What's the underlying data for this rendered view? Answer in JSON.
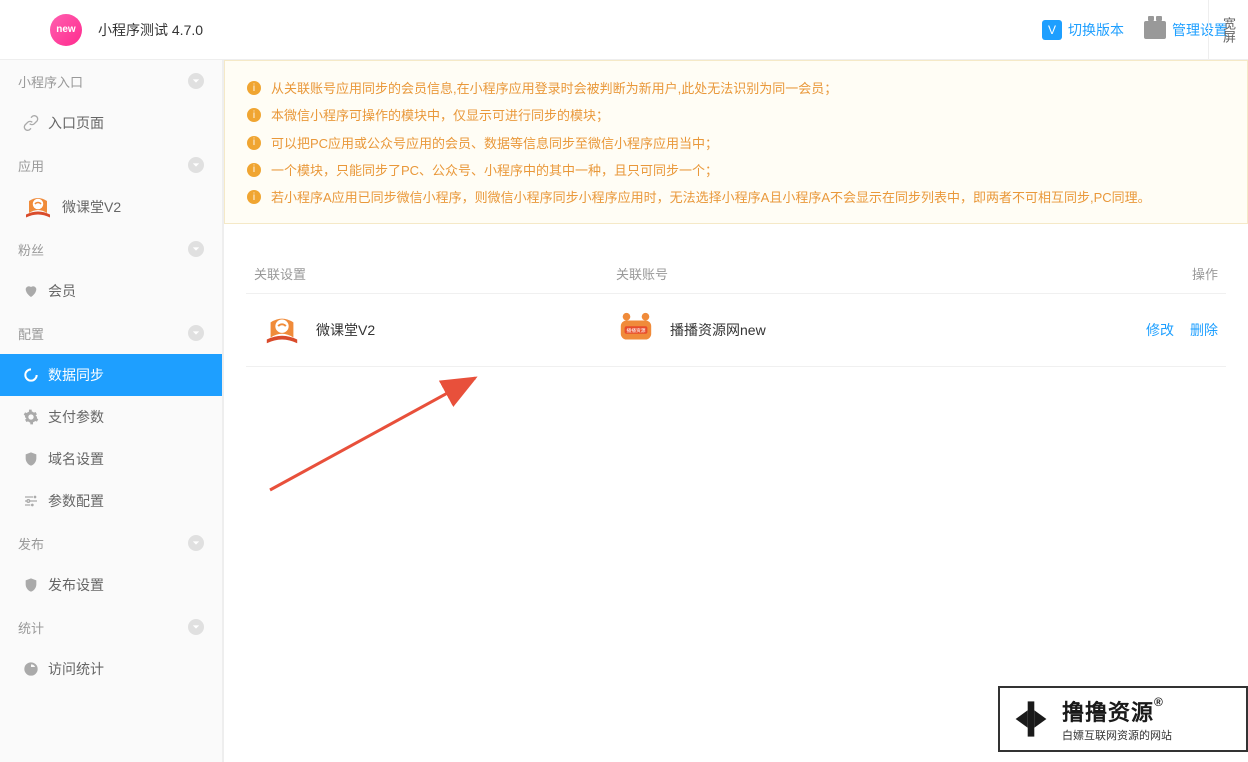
{
  "header": {
    "title": "小程序测试 4.7.0",
    "switch_label": "切换版本",
    "manage_label": "管理设置",
    "side_button": "宽屏"
  },
  "sidebar": {
    "groups": [
      {
        "label": "小程序入口",
        "items": [
          {
            "label": "入口页面",
            "icon": "link-icon"
          }
        ]
      },
      {
        "label": "应用",
        "items": [
          {
            "label": "微课堂V2",
            "icon": "wkt-icon"
          }
        ]
      },
      {
        "label": "粉丝",
        "items": [
          {
            "label": "会员",
            "icon": "heart-icon"
          }
        ]
      },
      {
        "label": "配置",
        "items": [
          {
            "label": "数据同步",
            "icon": "sync-icon",
            "active": true
          },
          {
            "label": "支付参数",
            "icon": "gear-icon"
          },
          {
            "label": "域名设置",
            "icon": "shield-icon"
          },
          {
            "label": "参数配置",
            "icon": "sliders-icon"
          }
        ]
      },
      {
        "label": "发布",
        "items": [
          {
            "label": "发布设置",
            "icon": "shield-icon"
          }
        ]
      },
      {
        "label": "统计",
        "items": [
          {
            "label": "访问统计",
            "icon": "stats-icon"
          }
        ]
      }
    ]
  },
  "notice": {
    "lines": [
      "从关联账号应用同步的会员信息,在小程序应用登录时会被判断为新用户,此处无法识别为同一会员；",
      "本微信小程序可操作的模块中，仅显示可进行同步的模块；",
      "可以把PC应用或公众号应用的会员、数据等信息同步至微信小程序应用当中；",
      "一个模块，只能同步了PC、公众号、小程序中的其中一种，且只可同步一个；",
      "若小程序A应用已同步微信小程序，则微信小程序同步小程序应用时，无法选择小程序A且小程序A不会显示在同步列表中，即两者不可相互同步,PC同理。"
    ]
  },
  "table": {
    "headers": {
      "col1": "关联设置",
      "col2": "关联账号",
      "col3": "操作"
    },
    "rows": [
      {
        "app_name": "微课堂V2",
        "account_name": "播播资源网new",
        "edit_label": "修改",
        "delete_label": "删除"
      }
    ]
  },
  "watermark": {
    "big": "撸撸资源",
    "reg": "®",
    "small": "白嫖互联网资源的网站"
  }
}
